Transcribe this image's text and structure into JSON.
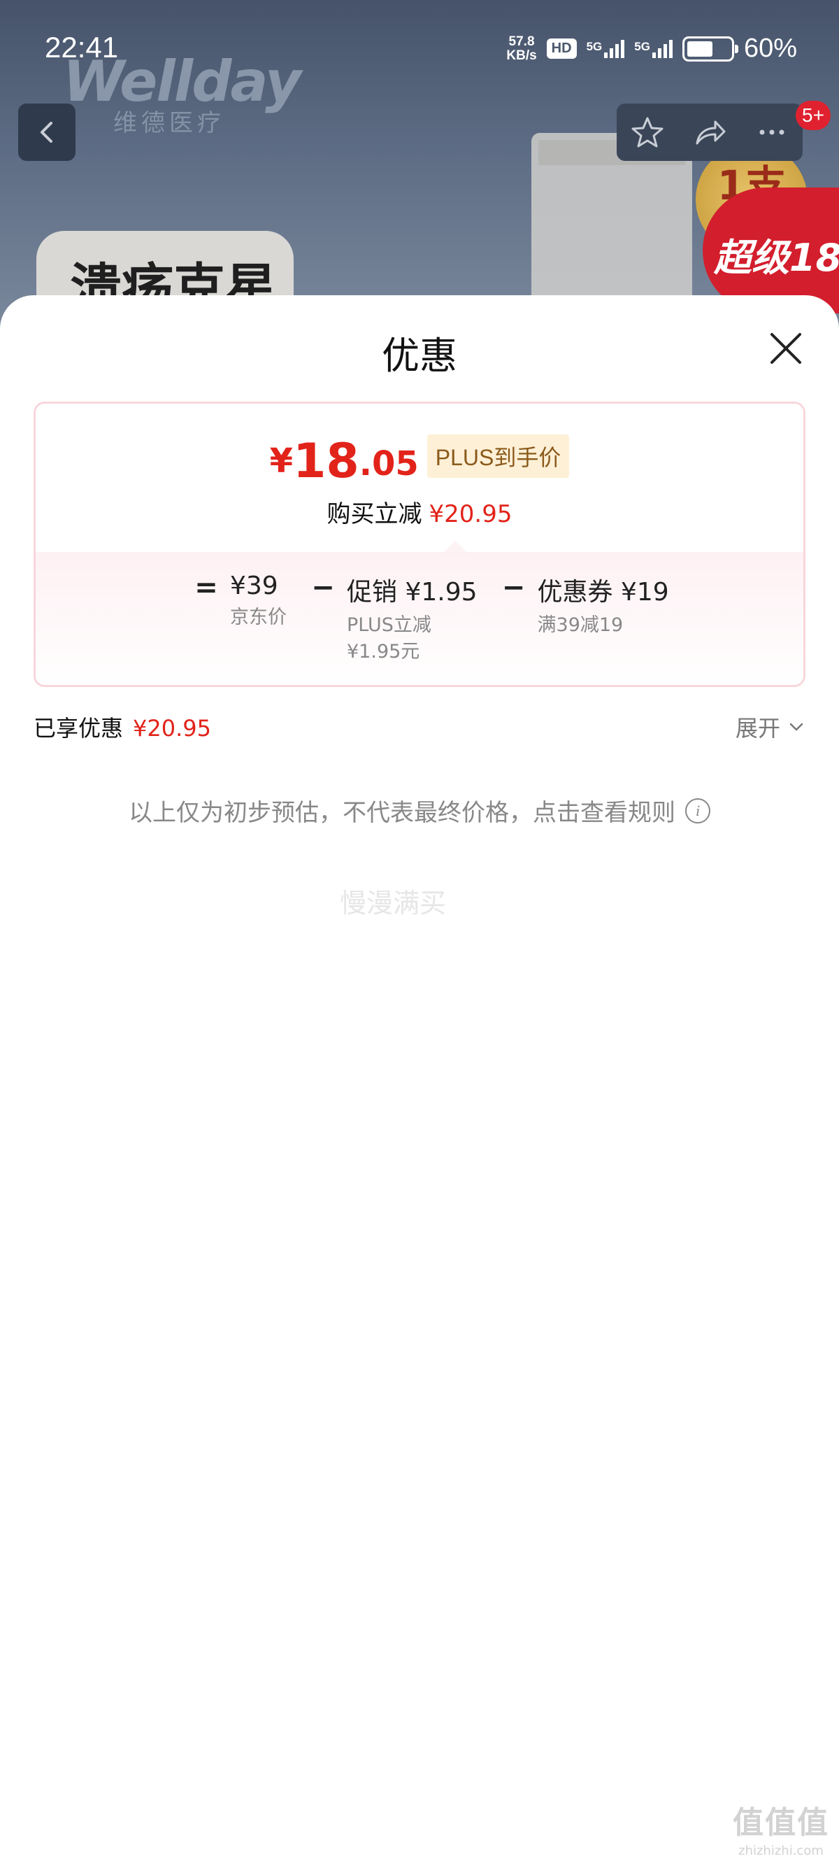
{
  "status_bar": {
    "time": "22:41",
    "net_speed_value": "57.8",
    "net_speed_unit": "KB/s",
    "hd_label": "HD",
    "signal1_label": "5G",
    "signal2_label": "5G",
    "battery_percent": "60%",
    "battery_level": 0.6
  },
  "background": {
    "brand_name": "Wellday",
    "brand_cn": "维德医疗",
    "product_tag": "溃疡克星",
    "badge_gold": "1支",
    "badge_red": "超级18",
    "notification_count": "5+"
  },
  "sheet": {
    "title": "优惠",
    "final_price": {
      "symbol": "¥",
      "integer": "18",
      "decimal": ".05",
      "tag": "PLUS到手价"
    },
    "reduce": {
      "label": "购买立减",
      "amount": "¥20.95"
    },
    "formula": {
      "equals": "=",
      "minus": "−",
      "terms": [
        {
          "main": "¥39",
          "sub": "京东价"
        },
        {
          "main": "促销 ¥1.95",
          "sub_lines": [
            "PLUS立减",
            "¥1.95元"
          ]
        },
        {
          "main": "优惠券 ¥19",
          "sub": "满39减19"
        }
      ]
    },
    "enjoyed": {
      "label": "已享优惠",
      "amount": "¥20.95"
    },
    "expand_label": "展开",
    "disclaimer": "以上仅为初步预估，不代表最终价格，点击查看规则",
    "faint_text": "慢漫满买"
  },
  "watermark": {
    "mark": "值值值",
    "url": "zhizhizhi.com"
  },
  "colors": {
    "accent_red": "#e2231a",
    "plus_tag_bg": "#fdf0d6",
    "card_border": "#f8d6dc"
  },
  "icons": [
    "back-icon",
    "star-icon",
    "share-icon",
    "more-icon",
    "close-icon",
    "chevron-down-icon",
    "info-icon"
  ]
}
